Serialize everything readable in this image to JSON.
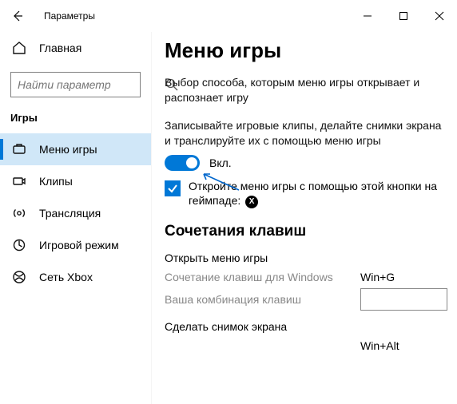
{
  "window": {
    "app_title": "Параметры"
  },
  "sidebar": {
    "home_label": "Главная",
    "search_placeholder": "Найти параметр",
    "group_label": "Игры",
    "items": [
      {
        "icon": "gamebar",
        "label": "Меню игры",
        "selected": true
      },
      {
        "icon": "clips",
        "label": "Клипы",
        "selected": false
      },
      {
        "icon": "broadcast",
        "label": "Трансляция",
        "selected": false
      },
      {
        "icon": "gamemode",
        "label": "Игровой режим",
        "selected": false
      },
      {
        "icon": "xboxnet",
        "label": "Сеть Xbox",
        "selected": false
      }
    ]
  },
  "content": {
    "title": "Меню игры",
    "lead": "Выбор способа, которым меню игры открывает и распознает игру",
    "record_para": "Записывайте игровые клипы, делайте снимки экрана и транслируйте их с помощью меню игры",
    "toggle": {
      "on": true,
      "label": "Вкл."
    },
    "controller_check": {
      "checked": true,
      "label": "Откройте меню игры с помощью этой кнопки на геймпаде:"
    },
    "shortcuts": {
      "heading": "Сочетания клавиш",
      "groups": [
        {
          "title": "Открыть меню игры",
          "rows": [
            {
              "label": "Сочетание клавиш для Windows",
              "value": "Win+G",
              "editable": false
            },
            {
              "label": "Ваша комбинация клавиш",
              "value": "",
              "editable": true
            }
          ]
        },
        {
          "title": "Сделать снимок экрана",
          "rows": [
            {
              "label": "",
              "value": "Win+Alt",
              "editable": false
            }
          ]
        }
      ]
    }
  }
}
